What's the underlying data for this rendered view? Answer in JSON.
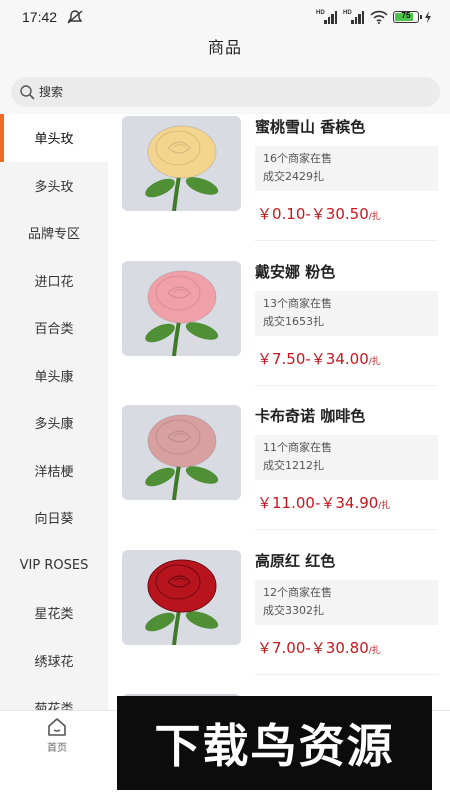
{
  "status_bar": {
    "time": "17:42",
    "battery_level": "75",
    "icons": [
      "mute-icon",
      "hd-signal-icon",
      "hd-signal-icon",
      "wifi-icon",
      "battery-icon",
      "charging-icon"
    ]
  },
  "header": {
    "title": "商品"
  },
  "search": {
    "placeholder": "搜索"
  },
  "sidebar": {
    "active_index": 0,
    "items": [
      {
        "label": "单头玫"
      },
      {
        "label": "多头玫"
      },
      {
        "label": "品牌专区"
      },
      {
        "label": "进口花"
      },
      {
        "label": "百合类"
      },
      {
        "label": "单头康"
      },
      {
        "label": "多头康"
      },
      {
        "label": "洋桔梗"
      },
      {
        "label": "向日葵"
      },
      {
        "label": "VIP ROSES"
      },
      {
        "label": "星花类"
      },
      {
        "label": "绣球花"
      },
      {
        "label": "菊花类"
      }
    ]
  },
  "products": [
    {
      "name": "蜜桃雪山 香槟色",
      "merchants": "16个商家在售",
      "sales": "成交2429扎",
      "price": "￥0.10-￥30.50",
      "unit": "/扎",
      "rose_color": "#f3d58e"
    },
    {
      "name": "戴安娜 粉色",
      "merchants": "13个商家在售",
      "sales": "成交1653扎",
      "price": "￥7.50-￥34.00",
      "unit": "/扎",
      "rose_color": "#f2a0a8"
    },
    {
      "name": "卡布奇诺 咖啡色",
      "merchants": "11个商家在售",
      "sales": "成交1212扎",
      "price": "￥11.00-￥34.90",
      "unit": "/扎",
      "rose_color": "#d9a0a0"
    },
    {
      "name": "高原红 红色",
      "merchants": "12个商家在售",
      "sales": "成交3302扎",
      "price": "￥7.00-￥30.80",
      "unit": "/扎",
      "rose_color": "#b8141e"
    }
  ],
  "bottom_nav": {
    "home_label": "首页"
  },
  "watermark": {
    "text": "下载鸟资源"
  },
  "colors": {
    "accent": "#ee6a25",
    "price": "#c8161d",
    "sidebar_bg": "#f4f4f4"
  }
}
